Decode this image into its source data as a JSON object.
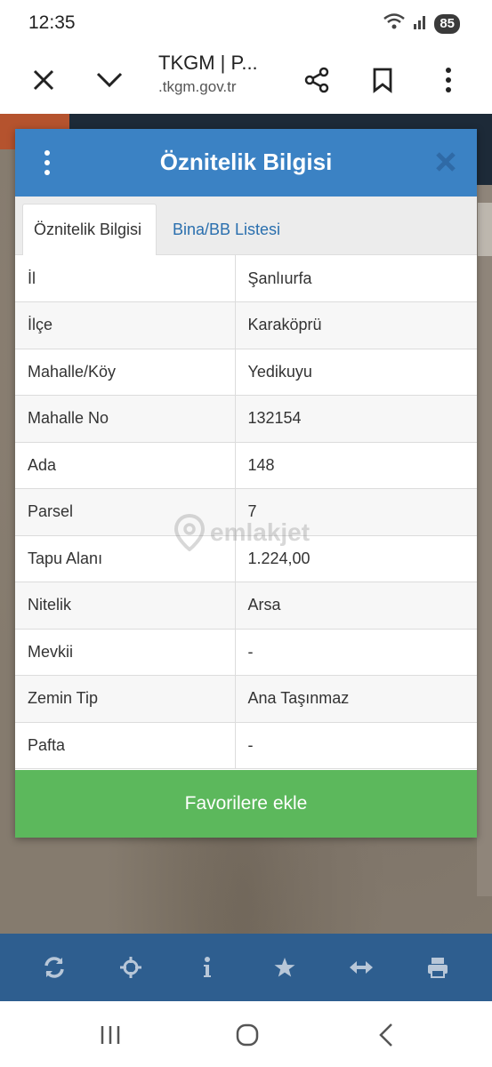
{
  "status_bar": {
    "time": "12:35",
    "battery": "85"
  },
  "browser": {
    "title": "TKGM | P...",
    "url": ".tkgm.gov.tr"
  },
  "dialog": {
    "title": "Öznitelik Bilgisi",
    "tabs": [
      {
        "label": "Öznitelik Bilgisi",
        "active": true
      },
      {
        "label": "Bina/BB Listesi",
        "active": false
      }
    ],
    "rows": [
      {
        "key": "İl",
        "value": "Şanlıurfa"
      },
      {
        "key": "İlçe",
        "value": "Karaköprü"
      },
      {
        "key": "Mahalle/Köy",
        "value": "Yedikuyu"
      },
      {
        "key": "Mahalle No",
        "value": "132154"
      },
      {
        "key": "Ada",
        "value": "148"
      },
      {
        "key": "Parsel",
        "value": "7"
      },
      {
        "key": "Tapu Alanı",
        "value": "1.224,00"
      },
      {
        "key": "Nitelik",
        "value": "Arsa"
      },
      {
        "key": "Mevkii",
        "value": "-"
      },
      {
        "key": "Zemin Tip",
        "value": "Ana Taşınmaz"
      },
      {
        "key": "Pafta",
        "value": "-"
      }
    ],
    "favorite_button": "Favorilere ekle"
  },
  "watermark": "emlakjet",
  "map_toolbar": [
    "refresh-icon",
    "crosshair-icon",
    "info-icon",
    "star-icon",
    "arrows-horizontal-icon",
    "print-icon"
  ],
  "colors": {
    "header_blue": "#3b82c4",
    "favorite_green": "#5cb85c",
    "toolbar_blue": "#2e5e8f",
    "tab_link": "#2a6fae"
  }
}
